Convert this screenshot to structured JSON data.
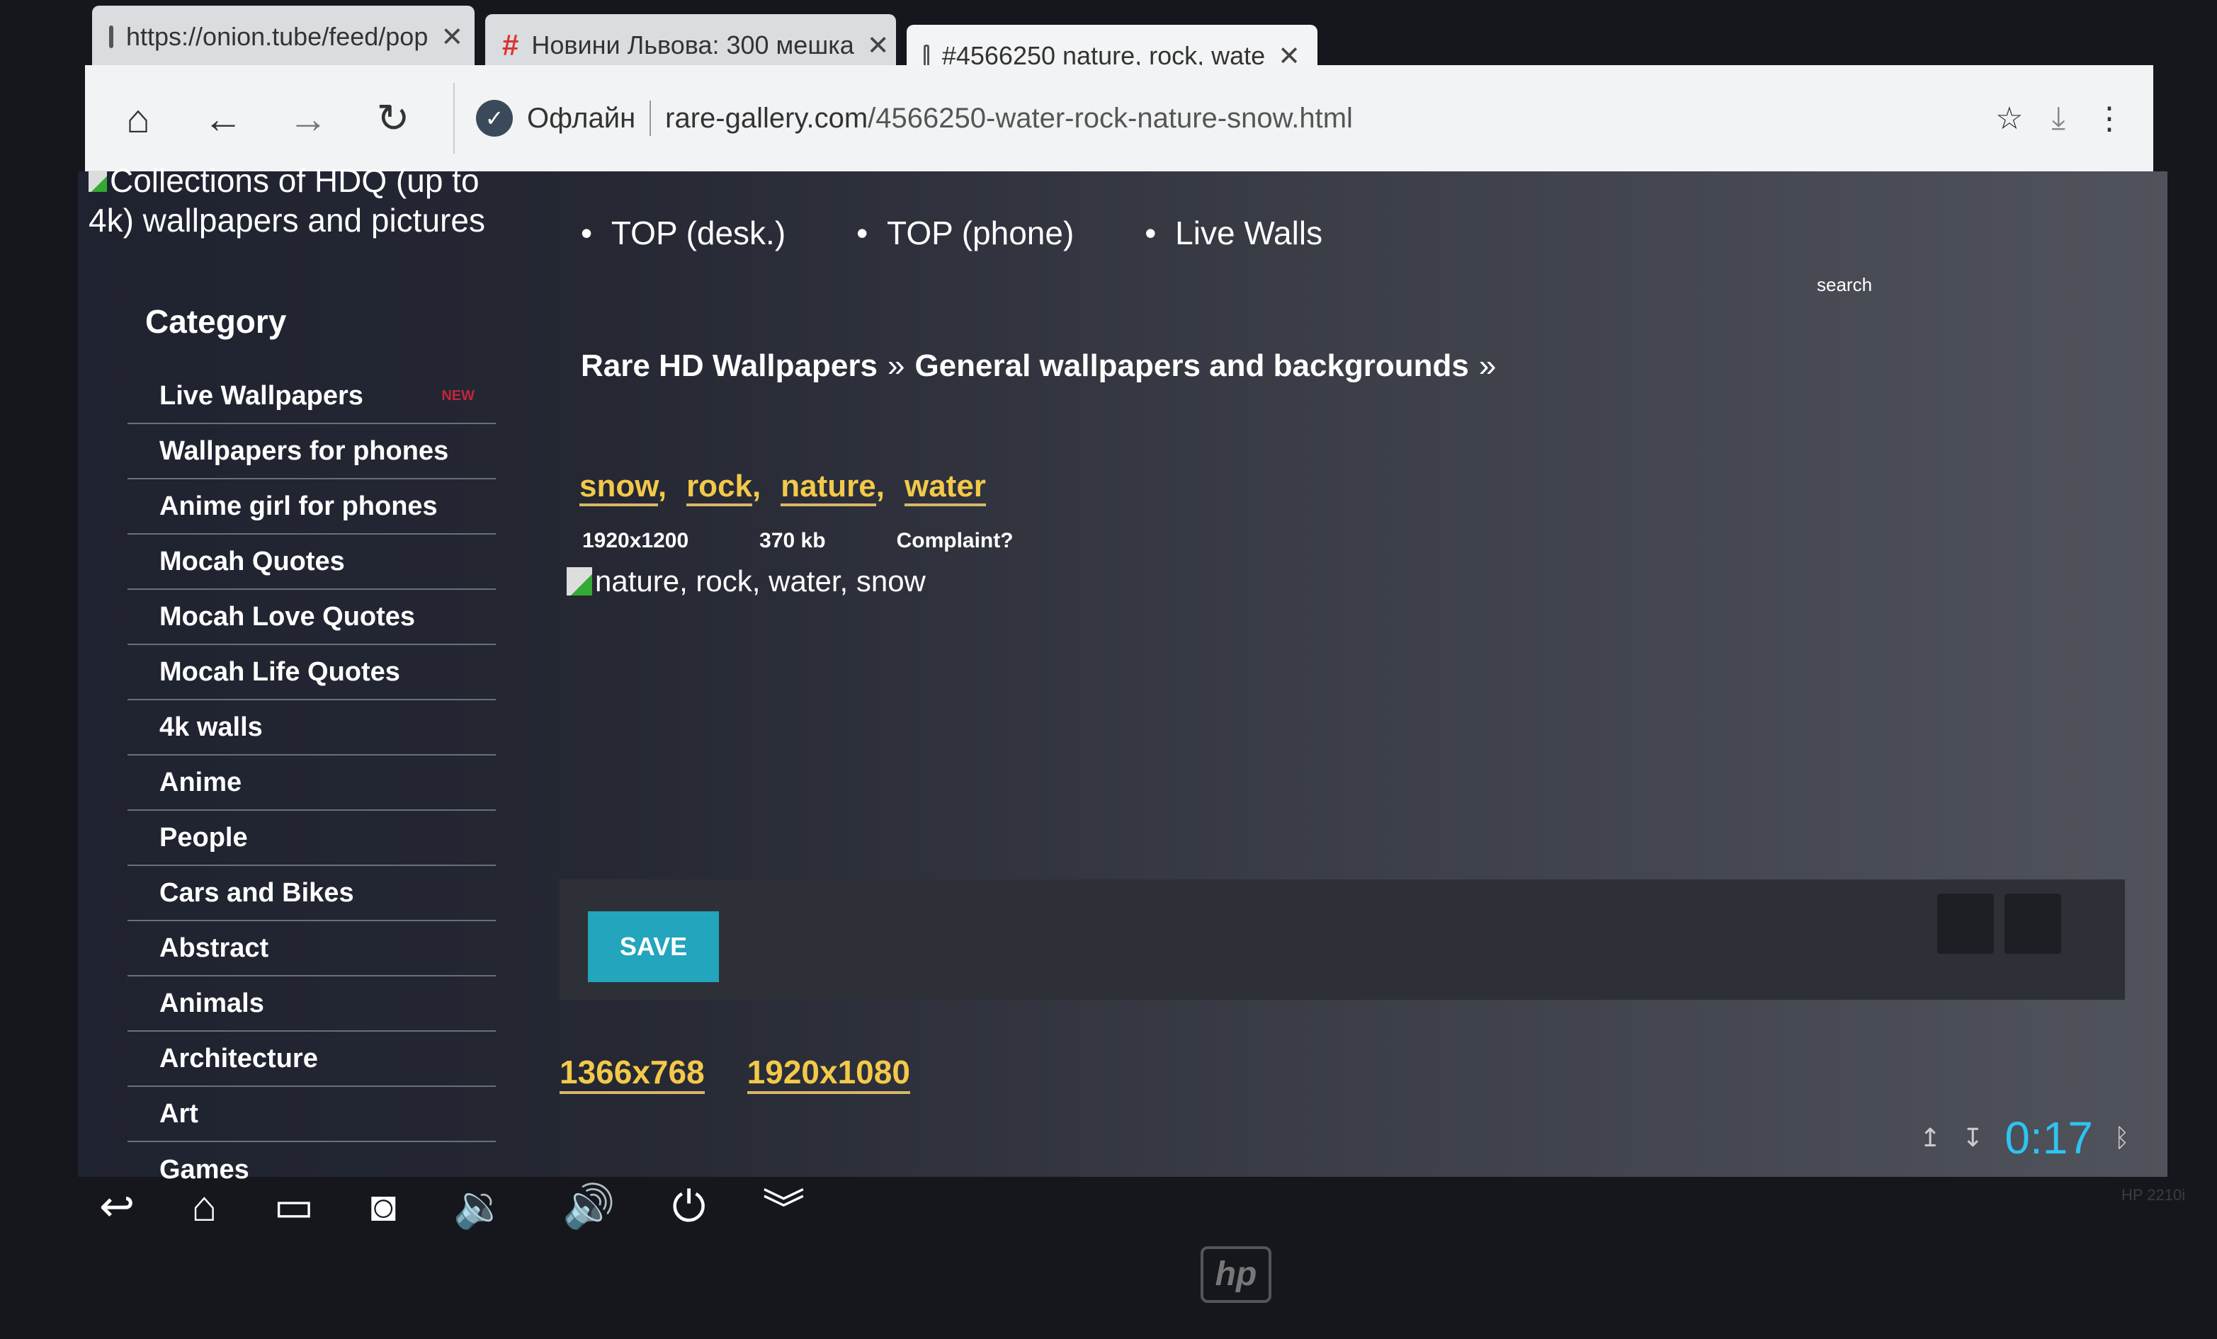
{
  "browser": {
    "tabs": [
      {
        "title": "https://onion.tube/feed/pop",
        "icon": "document-icon",
        "active": false
      },
      {
        "title": "Новини Львова: 300 мешка",
        "icon": "hash-icon",
        "active": false
      },
      {
        "title": "#4566250 nature, rock, wate",
        "icon": "document-icon",
        "active": true
      }
    ],
    "offline_label": "Офлайн",
    "url_domain": "rare-gallery.com",
    "url_path": "/4566250-water-rock-nature-snow.html"
  },
  "header": {
    "logo_alt": "Collections of HDQ (up to 4k) wallpapers and pictures",
    "nav": [
      "TOP (desk.)",
      "TOP (phone)",
      "Live Walls"
    ],
    "search_label": "search"
  },
  "sidebar": {
    "title": "Category",
    "badge": "NEW",
    "items": [
      "Live Wallpapers",
      "Wallpapers for phones",
      "Anime girl for phones",
      "Mocah Quotes",
      "Mocah Love Quotes",
      "Mocah Life Quotes",
      "4k walls",
      "Anime",
      "People",
      "Cars and Bikes",
      "Abstract",
      "Animals",
      "Architecture",
      "Art",
      "Games"
    ]
  },
  "main": {
    "breadcrumb": [
      "Rare HD Wallpapers",
      "General wallpapers and backgrounds"
    ],
    "breadcrumb_sep": "»",
    "tags": [
      "snow",
      "rock",
      "nature",
      "water"
    ],
    "resolution": "1920x1200",
    "size": "370 kb",
    "complaint": "Complaint?",
    "image_alt": "nature, rock, water, snow",
    "save_label": "SAVE",
    "resolutions": [
      "1366x768",
      "1920x1080"
    ]
  },
  "system": {
    "clock": "0:17",
    "clock_color": "#2fc3f0",
    "accent": "#22a5bd",
    "tag_color": "#f3c94a",
    "monitor_model": "HP 2210i",
    "brand": "hp"
  }
}
